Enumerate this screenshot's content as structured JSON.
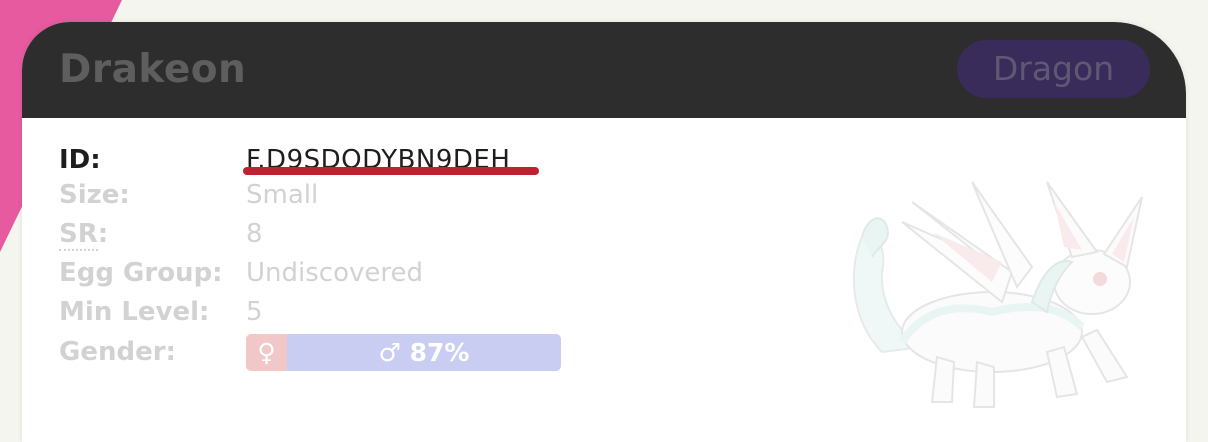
{
  "card": {
    "title": "Drakeon",
    "type_badge": "Dragon"
  },
  "info": {
    "id_label": "ID:",
    "id_value": "F.D9SDQDYBN9DEH",
    "size_label": "Size:",
    "size_value": "Small",
    "sr_label": "SR",
    "sr_colon": ":",
    "sr_value": "8",
    "egg_group_label": "Egg Group:",
    "egg_group_value": "Undiscovered",
    "min_level_label": "Min Level:",
    "min_level_value": "5",
    "gender_label": "Gender:"
  },
  "gender": {
    "female_text": "♀ 13%",
    "male_text": "♂ 87%",
    "female_fraction": 0.13,
    "male_fraction": 0.87
  },
  "colors": {
    "header_bg": "#2d2d2d",
    "badge_bg": "#3a2c5a",
    "id_underline": "#c0212e",
    "accent_pink": "#e85aa0"
  },
  "icons": {
    "sprite": "creature-sprite",
    "female": "female-symbol",
    "male": "male-symbol"
  }
}
